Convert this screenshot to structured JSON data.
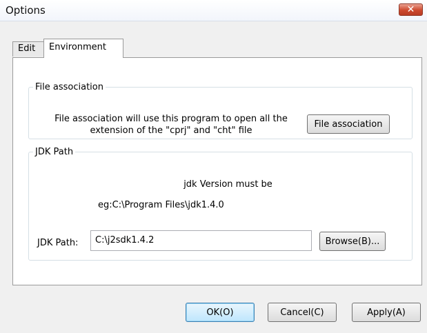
{
  "window": {
    "title": "Options",
    "close_glyph": "✕"
  },
  "tabs": [
    {
      "label": "Edit",
      "active": false
    },
    {
      "label": "Environment",
      "active": true
    }
  ],
  "file_association": {
    "legend": "File association",
    "description_line1": "File association will use this program to open all the",
    "description_line2": "extension of the \"cprj\" and \"cht\" file",
    "button_label": "File association"
  },
  "jdk_path": {
    "legend": "JDK Path",
    "note_line1": "jdk Version must be",
    "note_line2": "eg:C:\\Program Files\\jdk1.4.0",
    "field_label": "JDK Path:",
    "field_value": "C:\\j2sdk1.4.2",
    "browse_label": "Browse(B)..."
  },
  "footer": {
    "ok_label": "OK(O)",
    "cancel_label": "Cancel(C)",
    "apply_label": "Apply(A)"
  }
}
